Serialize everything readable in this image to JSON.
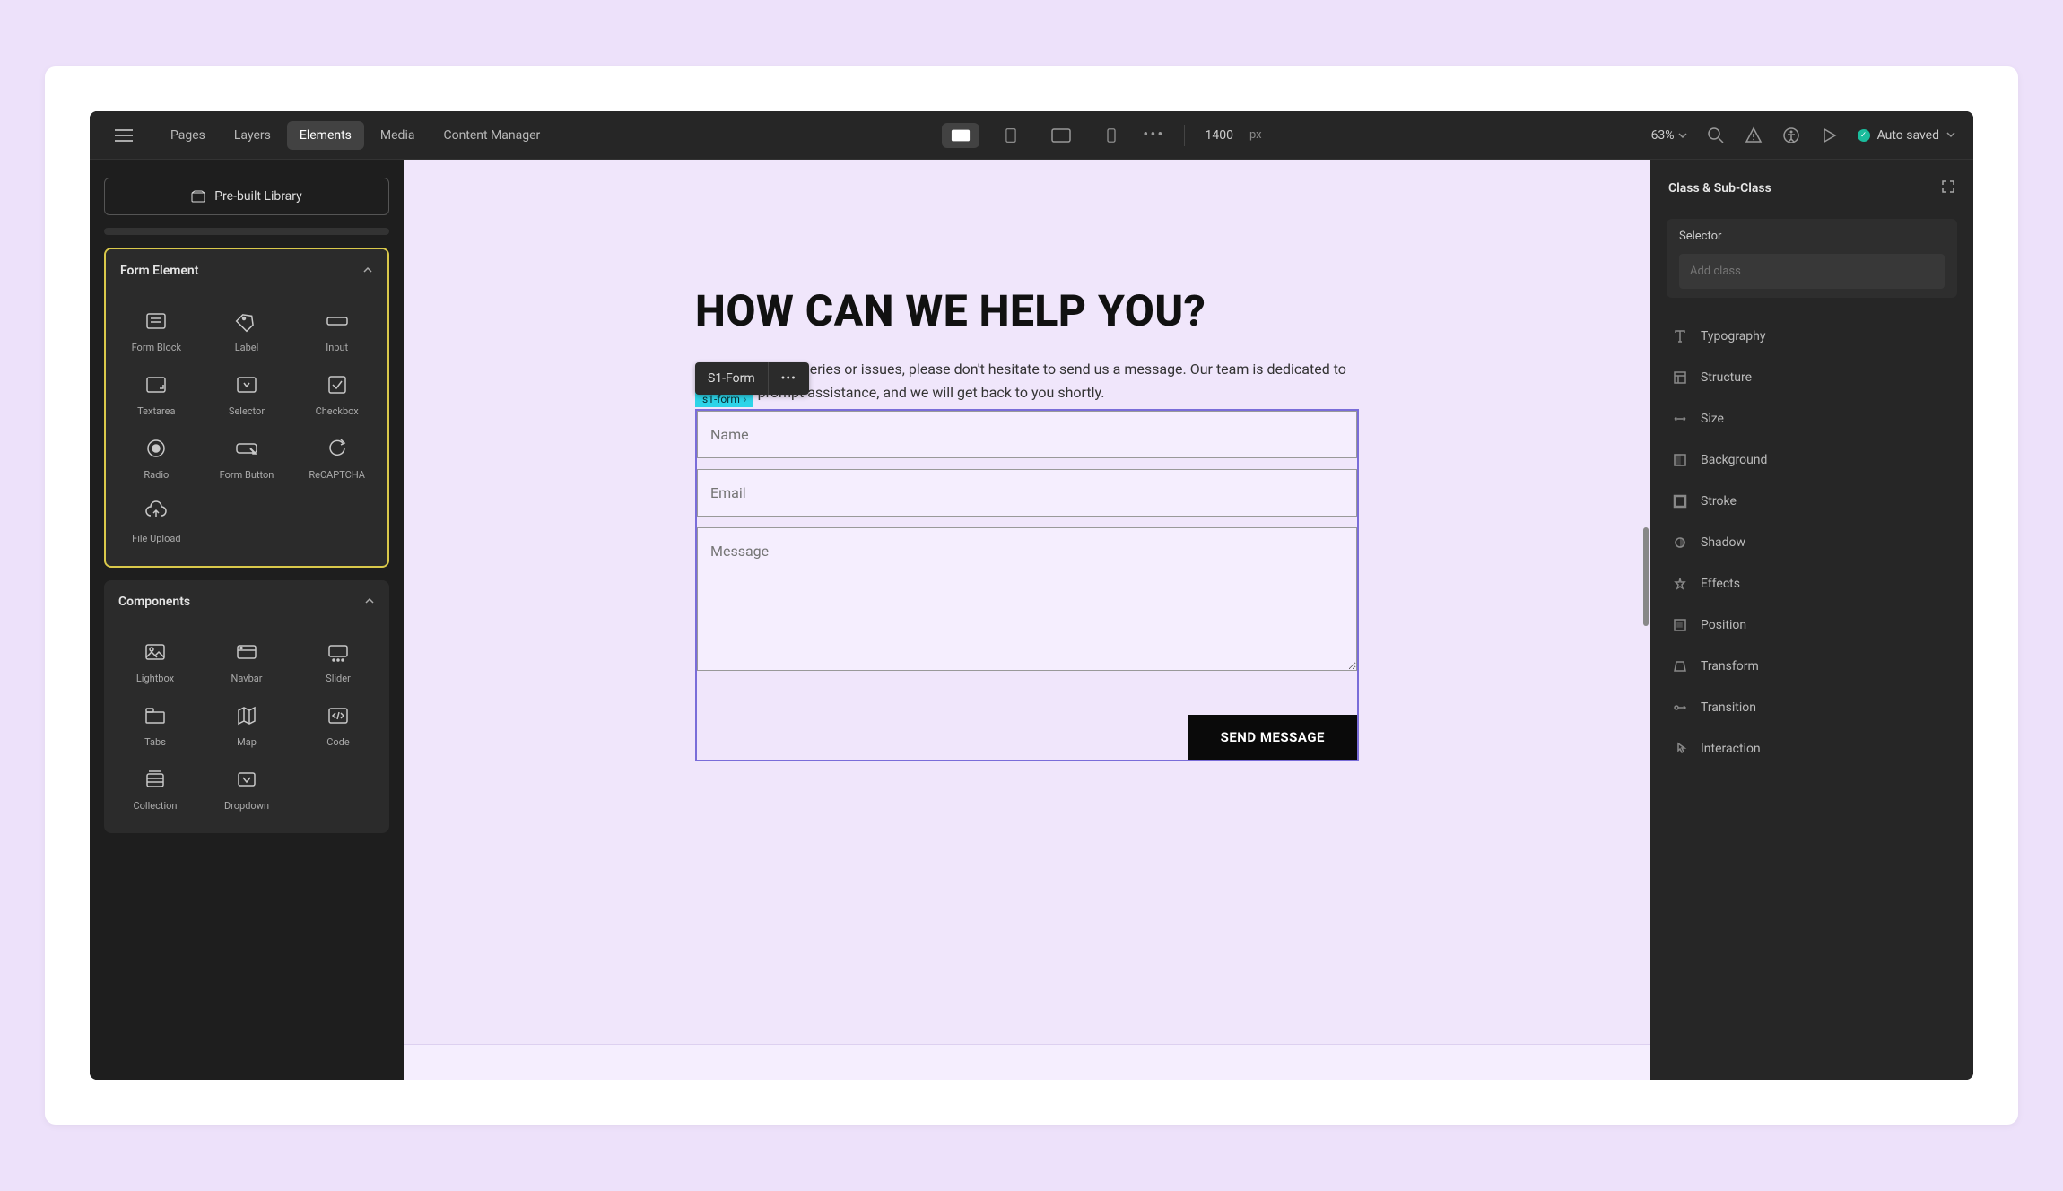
{
  "topbar": {
    "tabs": [
      "Pages",
      "Layers",
      "Elements",
      "Media",
      "Content Manager"
    ],
    "active_tab_index": 2,
    "viewport_width": "1400",
    "viewport_unit": "px",
    "zoom": "63%",
    "auto_saved": "Auto saved"
  },
  "left_panel": {
    "prebuilt_label": "Pre-built Library",
    "sections": {
      "form": {
        "title": "Form Element",
        "items": [
          "Form Block",
          "Label",
          "Input",
          "Textarea",
          "Selector",
          "Checkbox",
          "Radio",
          "Form Button",
          "ReCAPTCHA",
          "File Upload"
        ]
      },
      "components": {
        "title": "Components",
        "items": [
          "Lightbox",
          "Navbar",
          "Slider",
          "Tabs",
          "Map",
          "Code",
          "Collection",
          "Dropdown"
        ]
      }
    }
  },
  "canvas": {
    "heading": "HOW CAN WE HELP YOU?",
    "description": "If you have any queries or issues, please don't hesitate to send us a message. Our team is dedicated to providing prompt assistance, and we will get back to you shortly.",
    "selected_element": "S1-Form",
    "class_chip": "s1-form",
    "form": {
      "name_placeholder": "Name",
      "email_placeholder": "Email",
      "message_placeholder": "Message",
      "submit_label": "SEND MESSAGE"
    }
  },
  "right_panel": {
    "header": "Class & Sub-Class",
    "selector_label": "Selector",
    "add_class_placeholder": "Add class",
    "style_sections": [
      "Typography",
      "Structure",
      "Size",
      "Background",
      "Stroke",
      "Shadow",
      "Effects",
      "Position",
      "Transform",
      "Transition",
      "Interaction"
    ]
  }
}
